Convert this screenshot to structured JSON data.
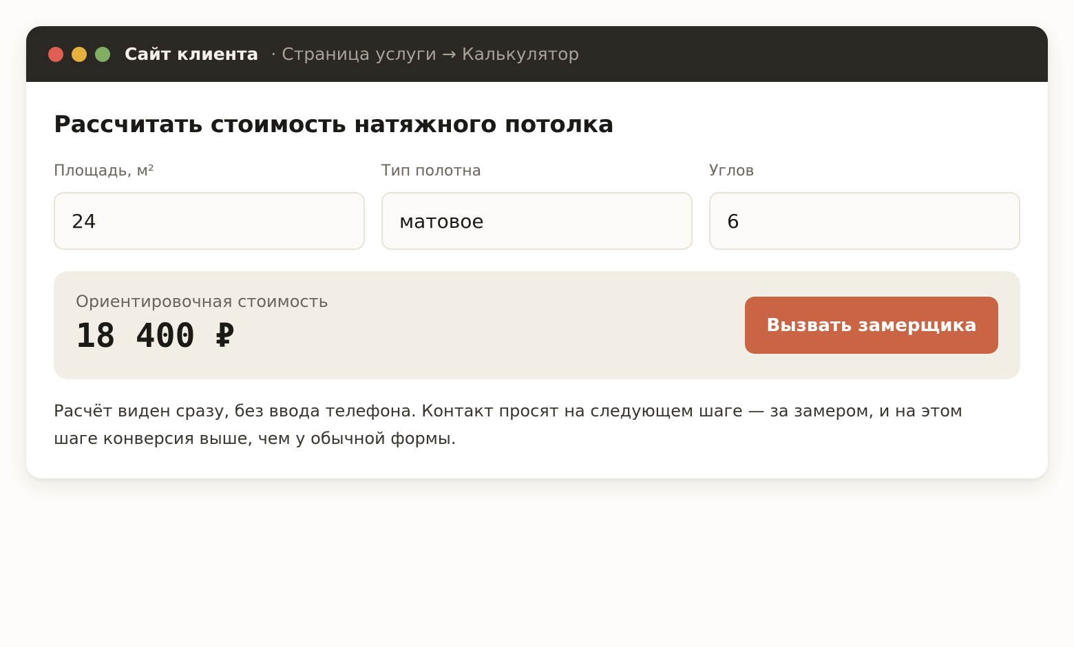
{
  "window": {
    "site_name": "Сайт клиента",
    "breadcrumb": "· Страница услуги → Калькулятор"
  },
  "calculator": {
    "title": "Рассчитать стоимость натяжного потолка",
    "fields": [
      {
        "label": "Площадь, м²",
        "value": "24"
      },
      {
        "label": "Тип полотна",
        "value": "матовое"
      },
      {
        "label": "Углов",
        "value": "6"
      }
    ],
    "result": {
      "label": "Ориентировочная стоимость",
      "value": "18 400 ₽"
    },
    "cta_label": "Вызвать замерщика",
    "note": "Расчёт виден сразу, без ввода телефона. Контакт просят на следующем шаге — за замером, и на этом шаге конверсия выше, чем у обычной формы."
  },
  "colors": {
    "page_background": "#fdfcf8",
    "titlebar": "#2b2823",
    "accent": "#c96544",
    "result_panel": "#f2eee5",
    "traffic_red": "#e05f54",
    "traffic_yellow": "#e4b23c",
    "traffic_green": "#80ae62"
  }
}
